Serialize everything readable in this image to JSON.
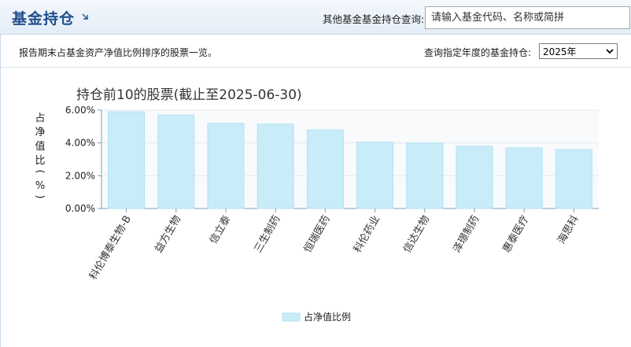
{
  "header": {
    "title": "基金持仓",
    "query_label": "其他基金基金持仓查询:",
    "search_placeholder": "请输入基金代码、名称或简拼"
  },
  "subbar": {
    "description": "报告期末占基金资产净值比例排序的股票一览。",
    "year_label": "查询指定年度的基金持仓:",
    "year_selected": "2025年"
  },
  "chart_data": {
    "type": "bar",
    "title": "持仓前10的股票(截止至2025-06-30)",
    "ylabel": "占净值比(%)",
    "ylim": [
      0,
      6
    ],
    "yticks": [
      "0.00%",
      "2.00%",
      "4.00%",
      "6.00%"
    ],
    "grid": true,
    "legend": "bottom-center",
    "categories": [
      "科伦博泰生物-B",
      "益方生物",
      "信立泰",
      "三生制药",
      "恒瑞医药",
      "科伦药业",
      "信达生物",
      "泽璟制药",
      "惠泰医疗",
      "海思科"
    ],
    "series": [
      {
        "name": "占净值比例",
        "values": [
          5.9,
          5.7,
          5.2,
          5.15,
          4.8,
          4.05,
          4.0,
          3.8,
          3.7,
          3.6
        ],
        "color": "#c8ecf8"
      }
    ]
  }
}
